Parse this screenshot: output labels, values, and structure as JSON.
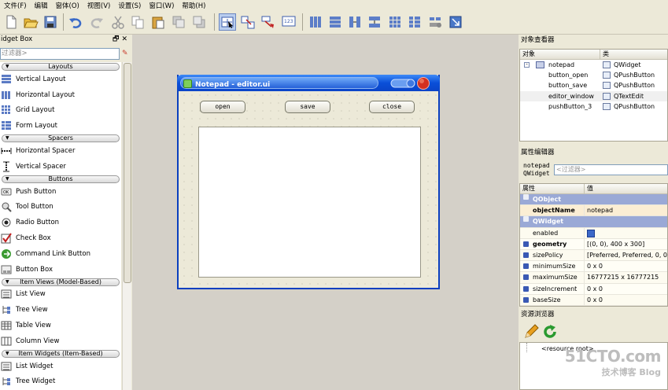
{
  "menu": [
    "文件(F)",
    "编辑",
    "窗体(O)",
    "视图(V)",
    "设置(S)",
    "窗口(W)",
    "帮助(H)"
  ],
  "widget_box": {
    "title": "idget Box",
    "title_buttons": "🗗✕",
    "filter_placeholder": "过滤器>",
    "categories": [
      {
        "name": "Layouts",
        "items": [
          "Vertical Layout",
          "Horizontal Layout",
          "Grid Layout",
          "Form Layout"
        ]
      },
      {
        "name": "Spacers",
        "items": [
          "Horizontal Spacer",
          "Vertical Spacer"
        ]
      },
      {
        "name": "Buttons",
        "items": [
          "Push Button",
          "Tool Button",
          "Radio Button",
          "Check Box",
          "Command Link Button",
          "Button Box"
        ]
      },
      {
        "name": "Item Views (Model-Based)",
        "items": [
          "List View",
          "Tree View",
          "Table View",
          "Column View"
        ]
      },
      {
        "name": "Item Widgets (Item-Based)",
        "items": [
          "List Widget",
          "Tree Widget"
        ]
      }
    ]
  },
  "form": {
    "title": "Notepad - editor.ui",
    "buttons": [
      "open",
      "save",
      "close"
    ]
  },
  "object_inspector": {
    "title": "对象查看器",
    "columns": [
      "对象",
      "类"
    ],
    "rows": [
      {
        "object": "notepad",
        "class": "QWidget"
      },
      {
        "object": "button_open",
        "class": "QPushButton"
      },
      {
        "object": "button_save",
        "class": "QPushButton"
      },
      {
        "object": "editor_window",
        "class": "QTextEdit"
      },
      {
        "object": "pushButton_3",
        "class": "QPushButton"
      }
    ]
  },
  "property_editor": {
    "title": "属性编辑器",
    "object_name": "notepad",
    "object_class": "QWidget",
    "filter_placeholder": "<过滤器>",
    "columns": [
      "属性",
      "值"
    ],
    "rows": [
      {
        "group": "QObject"
      },
      {
        "name": "objectName",
        "value": "notepad",
        "bold": true
      },
      {
        "group": "QWidget"
      },
      {
        "name": "enabled",
        "check": true
      },
      {
        "name": "geometry",
        "value": "[(0, 0), 400 x 300]",
        "bold": true,
        "expand": true
      },
      {
        "name": "sizePolicy",
        "value": "[Preferred, Preferred, 0, 0]",
        "expand": true
      },
      {
        "name": "minimumSize",
        "value": "0 x 0",
        "expand": true
      },
      {
        "name": "maximumSize",
        "value": "16777215 x 16777215",
        "expand": true
      },
      {
        "name": "sizeIncrement",
        "value": "0 x 0",
        "expand": true
      },
      {
        "name": "baseSize",
        "value": "0 x 0",
        "expand": true
      }
    ]
  },
  "resource_browser": {
    "title": "资源浏览器",
    "root": "<resource root>"
  },
  "watermark": {
    "line1": "51CTO.com",
    "line2": "技术博客  Blog"
  }
}
